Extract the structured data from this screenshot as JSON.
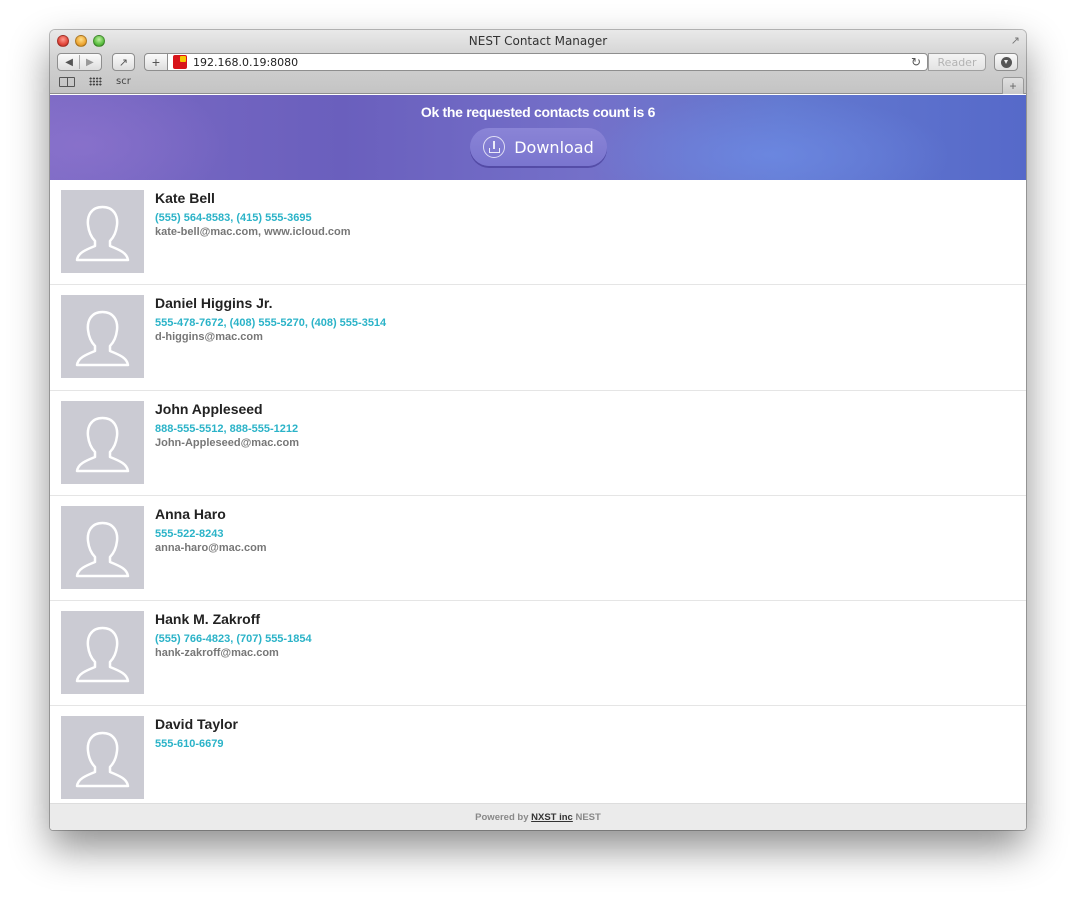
{
  "browser": {
    "window_title": "NEST Contact Manager",
    "url": "192.168.0.19:8080",
    "reader_label": "Reader",
    "add_bookmark_label": "+",
    "new_tab_label": "+",
    "bookmarks": [
      {
        "label": "scr"
      }
    ],
    "icons": {
      "back": "back-arrow-icon",
      "forward": "forward-arrow-icon",
      "share": "share-icon",
      "reload": "reload-icon",
      "downloads": "downloads-icon",
      "reading_list": "book-icon",
      "top_sites": "grid-icon",
      "fullscreen": "fullscreen-icon"
    }
  },
  "header": {
    "message": "Ok the requested contacts count is 6",
    "download_label": "Download",
    "colors": {
      "gradient_start": "#7b6ac4",
      "gradient_end": "#5669c9"
    }
  },
  "contacts": [
    {
      "name": "Kate Bell",
      "phones": "(555) 564-8583, (415) 555-3695",
      "emails": "kate-bell@mac.com, www.icloud.com"
    },
    {
      "name": "Daniel Higgins Jr.",
      "phones": "555-478-7672, (408) 555-5270, (408) 555-3514",
      "emails": "d-higgins@mac.com"
    },
    {
      "name": "John Appleseed",
      "phones": "888-555-5512, 888-555-1212",
      "emails": "John-Appleseed@mac.com"
    },
    {
      "name": "Anna Haro",
      "phones": "555-522-8243",
      "emails": "anna-haro@mac.com"
    },
    {
      "name": "Hank M. Zakroff",
      "phones": "(555) 766-4823, (707) 555-1854",
      "emails": "hank-zakroff@mac.com"
    },
    {
      "name": "David Taylor",
      "phones": "555-610-6679",
      "emails": ""
    }
  ],
  "footer": {
    "prefix": "Powered by",
    "company_link": "NXST inc",
    "suffix": "NEST"
  },
  "colors": {
    "phone_text": "#2bb3c8",
    "email_text": "#777777",
    "avatar_bg": "#cbcbd3"
  }
}
